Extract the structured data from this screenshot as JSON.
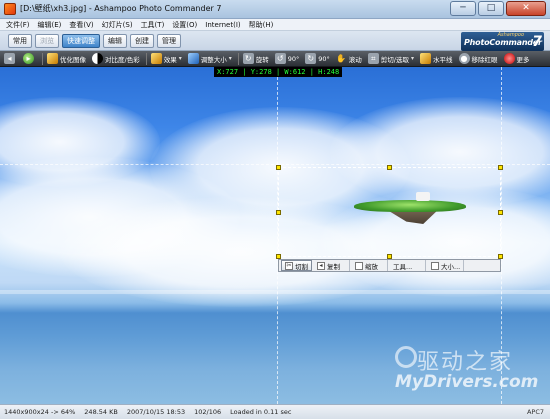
{
  "window": {
    "title": "[D:\\壁纸\\xh3.jpg] - Ashampoo Photo Commander 7",
    "min_label": "─",
    "max_label": "□",
    "close_label": "✕"
  },
  "menu": [
    "文件(F)",
    "编辑(E)",
    "查看(V)",
    "幻灯片(S)",
    "工具(T)",
    "设置(O)",
    "Internet(I)",
    "帮助(H)"
  ],
  "modes": [
    {
      "label": "常用",
      "state": "normal"
    },
    {
      "label": "浏览",
      "state": "disabled"
    },
    {
      "label": "快速调整",
      "state": "active"
    },
    {
      "label": "编辑",
      "state": "normal"
    },
    {
      "label": "创建",
      "state": "normal"
    },
    {
      "label": "管理",
      "state": "normal"
    }
  ],
  "logo": {
    "small": "Ashampoo",
    "main": "PhotoCommander",
    "version": "7"
  },
  "toolbar": {
    "optimize": "优化图像",
    "contrast": "对比度/色彩",
    "effects": "效果",
    "resize": "调整大小",
    "rotate": "旋转",
    "rotate_left": "90°",
    "rotate_right": "90°",
    "scroll": "滚动",
    "crop": "剪切/选取",
    "horizon": "水平线",
    "redeye": "移除红眼",
    "more": "更多"
  },
  "canvas": {
    "coord_readout": "X:727 | Y:278 | W:612 | H:248"
  },
  "crop_bar": {
    "cut": "切割",
    "copy": "复制",
    "zoom": "缩放",
    "tools": "工具...",
    "size": "大小..."
  },
  "watermark": {
    "cn": "驱动之家",
    "en": "MyDrivers.com"
  },
  "status": {
    "dimensions": "1440x900x24 -> 64%",
    "filesize": "248.54 KB",
    "date": "2007/10/15 18:53",
    "index": "102/106",
    "load": "Loaded in 0.11 sec",
    "right": "APC7"
  },
  "colors": {
    "accent": "#3f84c9",
    "readout": "#27ff3a",
    "handle": "#ffe600"
  }
}
